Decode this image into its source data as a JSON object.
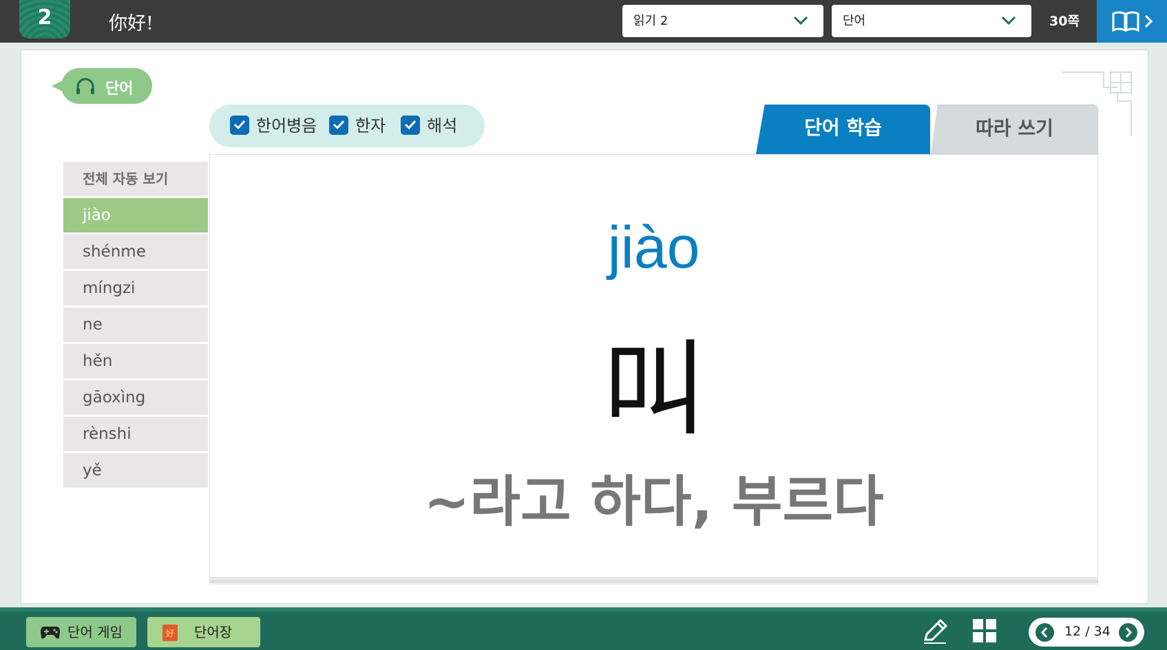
{
  "header": {
    "lesson_number": "2",
    "lesson_title": "你好!",
    "reading_select": "읽기 2",
    "section_select": "단어",
    "page_label": "30쪽"
  },
  "word_badge": {
    "label": "단어"
  },
  "options": [
    {
      "label": "한어병음",
      "checked": true
    },
    {
      "label": "한자",
      "checked": true
    },
    {
      "label": "해석",
      "checked": true
    }
  ],
  "tabs": {
    "study": "단어 학습",
    "write": "따라 쓰기"
  },
  "word_list": {
    "header": "전체 자동 보기",
    "items": [
      "jiào",
      "shénme",
      "míngzi",
      "ne",
      "hěn",
      "gāoxìng",
      "rènshi",
      "yě"
    ],
    "active_index": 0
  },
  "current_word": {
    "pinyin": "jiào",
    "hanzi": "叫",
    "meaning": "~라고 하다, 부르다"
  },
  "bottom": {
    "game_button": "단어 게임",
    "vocab_button": "단어장",
    "vocab_icon_char": "好",
    "page_current": "12",
    "page_total": "34",
    "page_display": "12 / 34"
  },
  "colors": {
    "accent_blue": "#0a7fc2",
    "green": "#8ec98a",
    "dark_green": "#1e6b5a",
    "topbar": "#3b3b3b"
  }
}
